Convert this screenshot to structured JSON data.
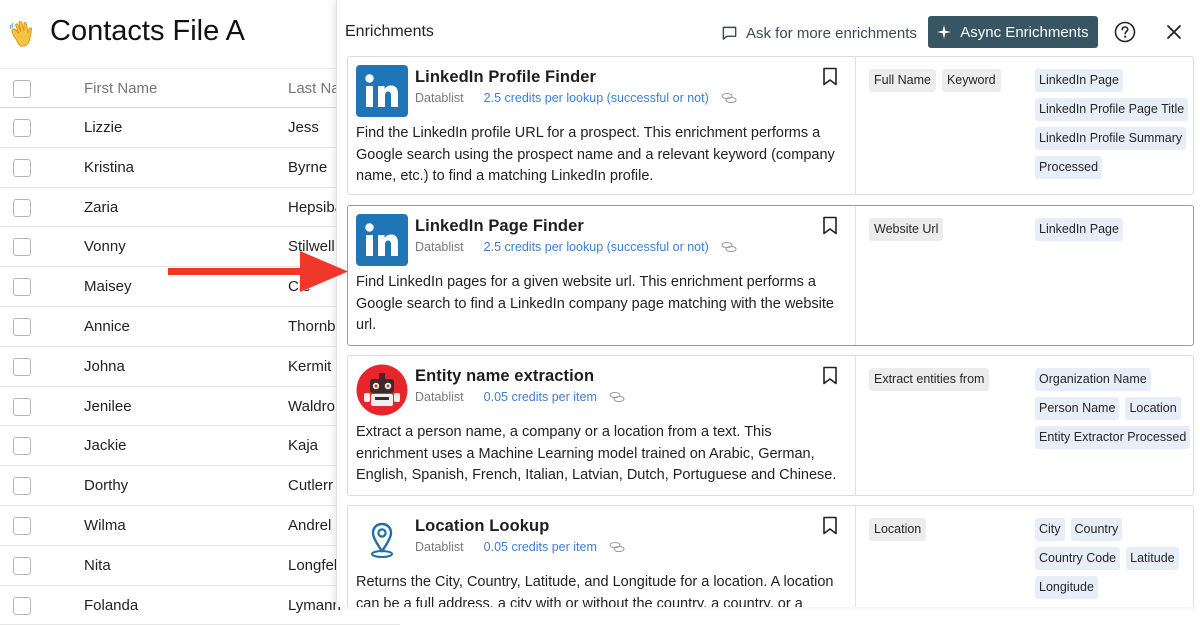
{
  "page": {
    "title": "Contacts File A",
    "emoji": "👋"
  },
  "table": {
    "headers": [
      "First Name",
      "Last Na"
    ],
    "rows": [
      [
        "Lizzie",
        "Jess"
      ],
      [
        "Kristina",
        "Byrne"
      ],
      [
        "Zaria",
        "Hepsiba"
      ],
      [
        "Vonny",
        "Stilwell"
      ],
      [
        "Maisey",
        "Cle"
      ],
      [
        "Annice",
        "Thornbu"
      ],
      [
        "Johna",
        "Kermit"
      ],
      [
        "Jenilee",
        "Waldron"
      ],
      [
        "Jackie",
        "Kaja"
      ],
      [
        "Dorthy",
        "Cutlerr"
      ],
      [
        "Wilma",
        "Andrel"
      ],
      [
        "Nita",
        "Longfel"
      ],
      [
        "Folanda",
        "Lymann"
      ]
    ]
  },
  "panel": {
    "title": "Enrichments",
    "ask_label": "Ask for more enrichments",
    "async_label": "Async Enrichments"
  },
  "cards": [
    {
      "name": "LinkedIn Profile Finder",
      "vendor": "Datablist",
      "price": "2.5 credits per lookup (successful or not)",
      "icon": "linkedin-logo",
      "description": "Find the LinkedIn profile URL for a prospect. This enrichment performs a Google search using the prospect name and a relevant keyword (company name, etc.) to find a matching LinkedIn profile.",
      "inputs": [
        "Full Name",
        "Keyword"
      ],
      "outputs": [
        "LinkedIn Page",
        "LinkedIn Profile Page Title",
        "LinkedIn Profile Summary",
        "Processed"
      ]
    },
    {
      "name": "LinkedIn Page Finder",
      "vendor": "Datablist",
      "price": "2.5 credits per lookup (successful or not)",
      "icon": "linkedin-logo",
      "description": "Find LinkedIn pages for a given website url. This enrichment performs a Google search to find a LinkedIn company page matching with the website url.",
      "inputs": [
        "Website Url"
      ],
      "outputs": [
        "LinkedIn Page"
      ]
    },
    {
      "name": "Entity name extraction",
      "vendor": "Datablist",
      "price": "0.05 credits per item",
      "icon": "robot-logo",
      "description": "Extract a person name, a company or a location from a text. This enrichment uses a Machine Learning model trained on Arabic, German, English, Spanish, French, Italian, Latvian, Dutch, Portuguese and Chinese.",
      "inputs": [
        "Extract entities from"
      ],
      "outputs": [
        "Organization Name",
        "Person Name",
        "Location",
        "Entity Extractor Processed"
      ]
    },
    {
      "name": "Location Lookup",
      "vendor": "Datablist",
      "price": "0.05 credits per item",
      "icon": "location-pin-logo",
      "description": "Returns the City, Country, Latitude, and Longitude for a location. A location can be a full address, a city with or without the country, a country, or a country",
      "inputs": [
        "Location"
      ],
      "outputs": [
        "City",
        "Country",
        "Country Code",
        "Latitude",
        "Longitude"
      ]
    }
  ],
  "colors": {
    "async_button": "#375563",
    "price_link": "#3b7fd4",
    "linkedin": "#1f75b6",
    "arrow": "#f0382a",
    "robot": "#e8252a"
  }
}
